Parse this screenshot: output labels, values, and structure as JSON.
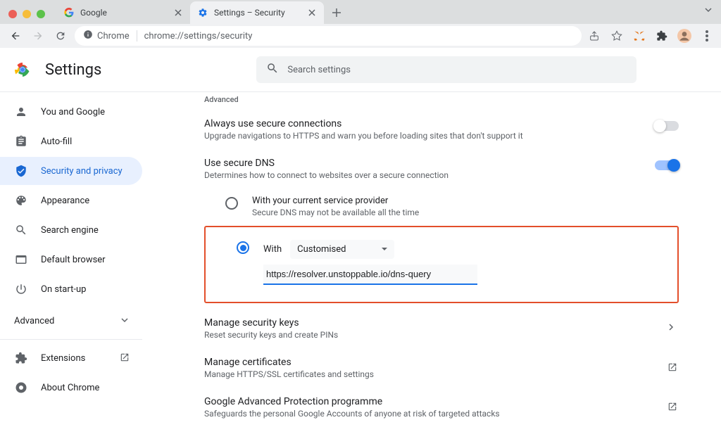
{
  "browser": {
    "tabs": [
      {
        "title": "Google"
      },
      {
        "title": "Settings – Security"
      }
    ],
    "address": {
      "scheme_icon": "lock",
      "app": "Chrome",
      "url": "chrome://settings/security"
    }
  },
  "header": {
    "settings_title": "Settings",
    "search_placeholder": "Search settings"
  },
  "sidebar": {
    "items": [
      {
        "label": "You and Google"
      },
      {
        "label": "Auto-fill"
      },
      {
        "label": "Security and privacy"
      },
      {
        "label": "Appearance"
      },
      {
        "label": "Search engine"
      },
      {
        "label": "Default browser"
      },
      {
        "label": "On start-up"
      }
    ],
    "advanced_label": "Advanced",
    "extensions_label": "Extensions",
    "about_label": "About Chrome"
  },
  "main": {
    "section_label": "Advanced",
    "secure_conn": {
      "title": "Always use secure connections",
      "desc": "Upgrade navigations to HTTPS and warn you before loading sites that don't support it"
    },
    "secure_dns": {
      "title": "Use secure DNS",
      "desc": "Determines how to connect to websites over a secure connection",
      "option_provider": {
        "title": "With your current service provider",
        "desc": "Secure DNS may not be available all the time"
      },
      "option_custom": {
        "label": "With",
        "dropdown_value": "Customised",
        "input_value": "https://resolver.unstoppable.io/dns-query"
      }
    },
    "manage_keys": {
      "title": "Manage security keys",
      "desc": "Reset security keys and create PINs"
    },
    "manage_certs": {
      "title": "Manage certificates",
      "desc": "Manage HTTPS/SSL certificates and settings"
    },
    "gap_program": {
      "title": "Google Advanced Protection programme",
      "desc": "Safeguards the personal Google Accounts of anyone at risk of targeted attacks"
    }
  }
}
